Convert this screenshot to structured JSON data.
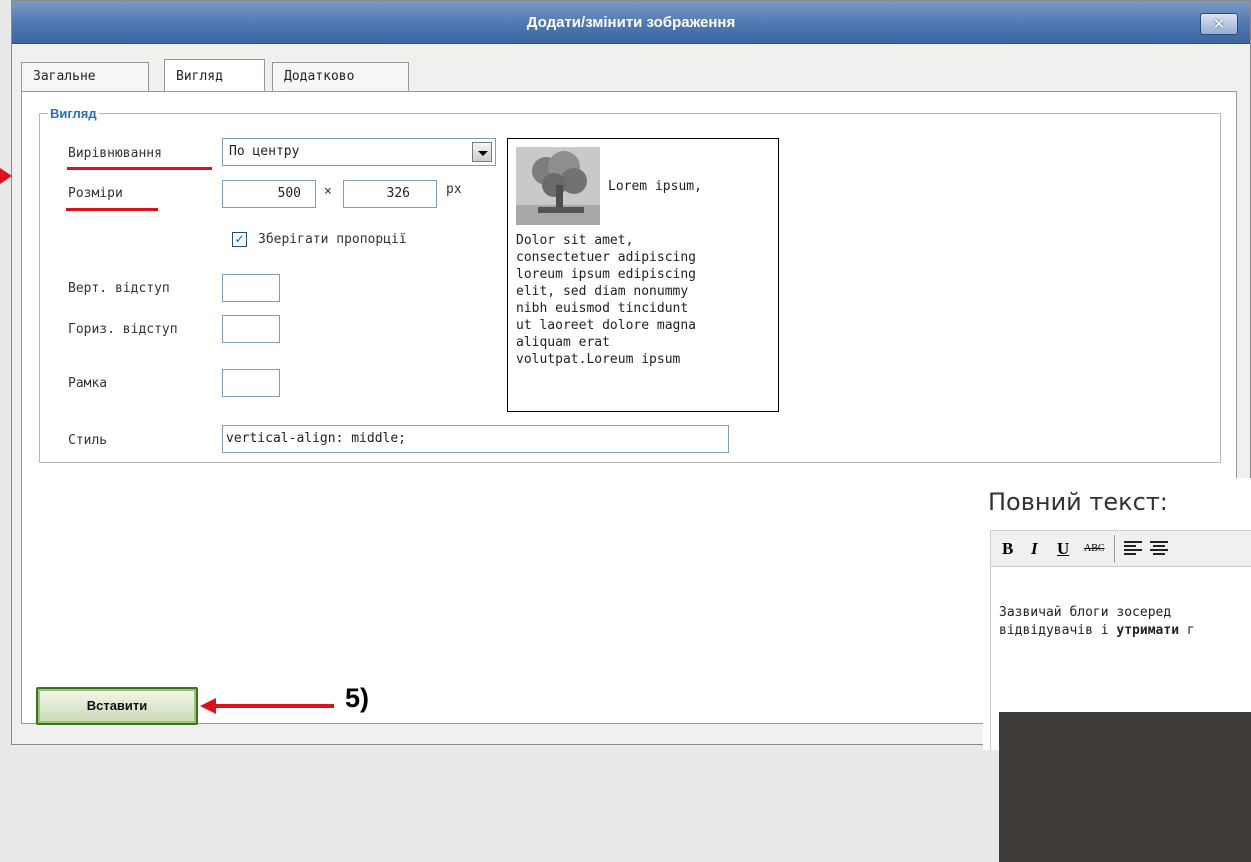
{
  "dialog": {
    "title": "Додати/змінити зображення",
    "close_symbol": "✕",
    "tabs": [
      {
        "label": "Загальне",
        "active": false
      },
      {
        "label": "Вигляд",
        "active": true
      },
      {
        "label": "Додатково",
        "active": false
      }
    ],
    "appearance": {
      "legend": "Вигляд",
      "alignment_label": "Вирівнювання",
      "alignment_value": "По центру",
      "dimensions_label": "Розміри",
      "width_value": "500",
      "times_symbol": "×",
      "height_value": "326",
      "unit": "px",
      "constrain_label": "Зберігати пропорції",
      "constrain_checked": true,
      "vspace_label": "Верт. відступ",
      "hspace_label": "Гориз. відступ",
      "border_label": "Рамка",
      "style_label": "Стиль",
      "style_value": "vertical-align: middle;",
      "preview": {
        "lead": "Lorem ipsum,",
        "lines": [
          "Dolor sit amet,",
          "consectetuer adipiscing",
          "loreum ipsum edipiscing",
          "elit, sed diam nonummy",
          "nibh euismod tincidunt",
          "ut laoreet dolore magna",
          "aliquam erat",
          "volutpat.Loreum ipsum"
        ]
      }
    },
    "insert_button": "Вставити"
  },
  "annotation": {
    "step_label": "5)",
    "color": "#d8141a"
  },
  "editor": {
    "heading": "Повний текст:",
    "toolbar": {
      "bold": "B",
      "italic": "I",
      "underline": "U",
      "strike": "ABC"
    },
    "content_line1": "Зазвичай блоги зосеред",
    "content_line2_start": "відвідувачів і ",
    "content_line2_bold": "утримати",
    "content_line2_end": " г"
  }
}
